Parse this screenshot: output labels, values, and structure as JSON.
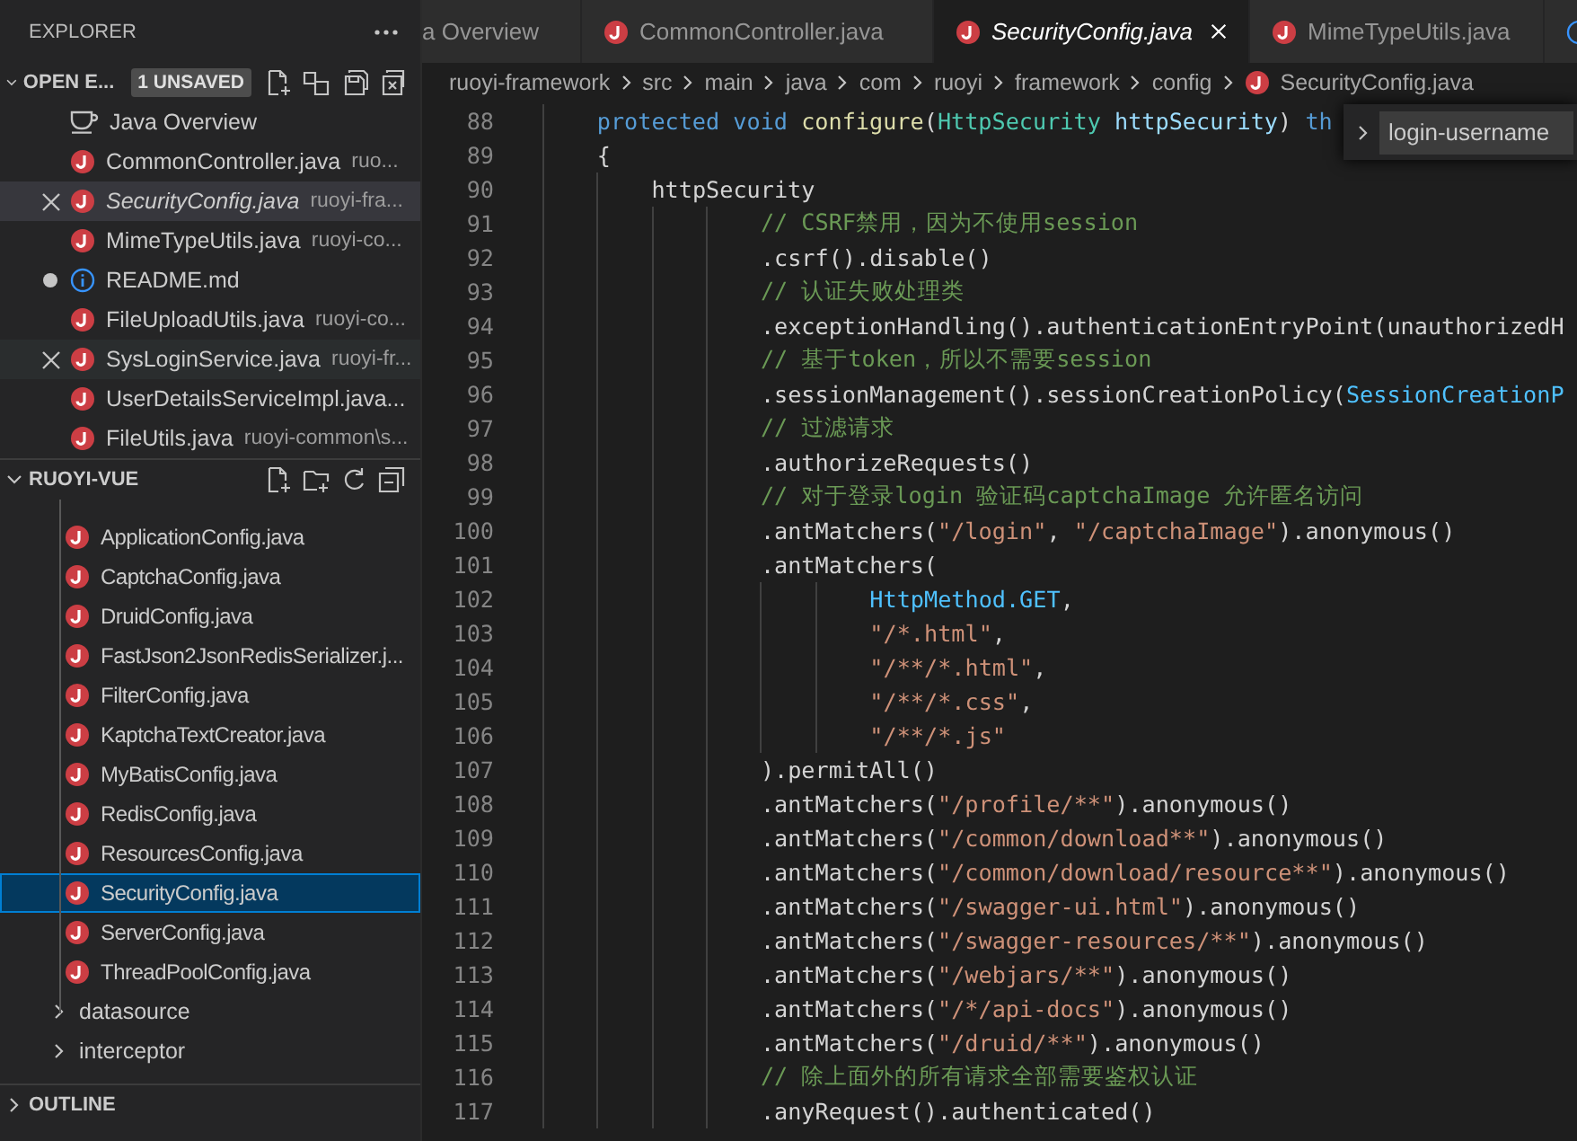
{
  "sidebar": {
    "title": "EXPLORER",
    "open_editors": {
      "title": "OPEN E...",
      "badge": "1 UNSAVED",
      "items": [
        {
          "kind": "overview",
          "name": "Java Overview",
          "selected": false,
          "hovered": false,
          "dirty": false,
          "preview": false
        },
        {
          "kind": "java",
          "name": "CommonController.java",
          "description": "ruo...",
          "selected": false,
          "hovered": false,
          "dirty": false,
          "preview": false
        },
        {
          "kind": "java",
          "name": "SecurityConfig.java",
          "description": "ruoyi-fra...",
          "selected": true,
          "hovered": false,
          "dirty": false,
          "preview": true
        },
        {
          "kind": "java",
          "name": "MimeTypeUtils.java",
          "description": "ruoyi-co...",
          "selected": false,
          "hovered": false,
          "dirty": false,
          "preview": false
        },
        {
          "kind": "info",
          "name": "README.md",
          "selected": false,
          "hovered": false,
          "dirty": true,
          "preview": false
        },
        {
          "kind": "java",
          "name": "FileUploadUtils.java",
          "description": "ruoyi-co...",
          "selected": false,
          "hovered": false,
          "dirty": false,
          "preview": false
        },
        {
          "kind": "java",
          "name": "SysLoginService.java",
          "description": "ruoyi-fr...",
          "selected": false,
          "hovered": true,
          "dirty": false,
          "preview": false
        },
        {
          "kind": "java",
          "name": "UserDetailsServiceImpl.java...",
          "selected": false,
          "hovered": false,
          "dirty": false,
          "preview": false
        },
        {
          "kind": "java",
          "name": "FileUtils.java",
          "description": "ruoyi-common\\s...",
          "selected": false,
          "hovered": false,
          "dirty": false,
          "preview": false
        }
      ]
    },
    "project": {
      "title": "RUOYI-VUE",
      "config_files": [
        {
          "name": "ApplicationConfig.java",
          "selected": false
        },
        {
          "name": "CaptchaConfig.java",
          "selected": false
        },
        {
          "name": "DruidConfig.java",
          "selected": false
        },
        {
          "name": "FastJson2JsonRedisSerializer.j...",
          "selected": false
        },
        {
          "name": "FilterConfig.java",
          "selected": false
        },
        {
          "name": "KaptchaTextCreator.java",
          "selected": false
        },
        {
          "name": "MyBatisConfig.java",
          "selected": false
        },
        {
          "name": "RedisConfig.java",
          "selected": false
        },
        {
          "name": "ResourcesConfig.java",
          "selected": false
        },
        {
          "name": "SecurityConfig.java",
          "selected": true
        },
        {
          "name": "ServerConfig.java",
          "selected": false
        },
        {
          "name": "ThreadPoolConfig.java",
          "selected": false
        }
      ],
      "folders": [
        {
          "name": "datasource",
          "expanded": false
        },
        {
          "name": "interceptor",
          "expanded": false
        }
      ]
    },
    "outline": {
      "title": "OUTLINE",
      "expanded": false
    }
  },
  "tabs": [
    {
      "kind": "none",
      "label": "a Overview",
      "selected": false,
      "preview": false
    },
    {
      "kind": "java",
      "label": "CommonController.java",
      "selected": false,
      "preview": false
    },
    {
      "kind": "java",
      "label": "SecurityConfig.java",
      "selected": true,
      "preview": true
    },
    {
      "kind": "java",
      "label": "MimeTypeUtils.java",
      "selected": false,
      "preview": false
    },
    {
      "kind": "info",
      "selected": false
    }
  ],
  "breadcrumbs": [
    {
      "label": "ruoyi-framework"
    },
    {
      "label": "src"
    },
    {
      "label": "main"
    },
    {
      "label": "java"
    },
    {
      "label": "com"
    },
    {
      "label": "ruoyi"
    },
    {
      "label": "framework"
    },
    {
      "label": "config"
    },
    {
      "label": "SecurityConfig.java",
      "kind": "java"
    }
  ],
  "find_widget": {
    "expanded": false,
    "value": "login-username"
  },
  "editor": {
    "lines": [
      {
        "number": "88",
        "tokens": [
          {
            "kind": "keyword",
            "text": "    protected void "
          },
          {
            "kind": "function",
            "text": "configure"
          },
          {
            "kind": "plain",
            "text": "("
          },
          {
            "kind": "type",
            "text": "HttpSecurity "
          },
          {
            "kind": "variable",
            "text": "httpSecurity"
          },
          {
            "kind": "plain",
            "text": ") "
          },
          {
            "kind": "keyword",
            "text": "th"
          }
        ]
      },
      {
        "number": "89",
        "tokens": [
          {
            "kind": "plain",
            "text": "    {"
          }
        ]
      },
      {
        "number": "90",
        "tokens": [
          {
            "kind": "plain",
            "text": "        httpSecurity"
          }
        ]
      },
      {
        "number": "91",
        "tokens": [
          {
            "kind": "comment",
            "text": "                // CSRF禁用，因为不使用session"
          }
        ]
      },
      {
        "number": "92",
        "tokens": [
          {
            "kind": "plain",
            "text": "                .csrf().disable()"
          }
        ]
      },
      {
        "number": "93",
        "tokens": [
          {
            "kind": "comment",
            "text": "                // 认证失败处理类"
          }
        ]
      },
      {
        "number": "94",
        "tokens": [
          {
            "kind": "plain",
            "text": "                .exceptionHandling().authenticationEntryPoint(unauthorizedH"
          }
        ]
      },
      {
        "number": "95",
        "tokens": [
          {
            "kind": "comment",
            "text": "                // 基于token，所以不需要session"
          }
        ]
      },
      {
        "number": "96",
        "tokens": [
          {
            "kind": "plain",
            "text": "                .sessionManagement().sessionCreationPolicy("
          },
          {
            "kind": "constant",
            "text": "SessionCreationP"
          }
        ]
      },
      {
        "number": "97",
        "tokens": [
          {
            "kind": "comment",
            "text": "                // 过滤请求"
          }
        ]
      },
      {
        "number": "98",
        "tokens": [
          {
            "kind": "plain",
            "text": "                .authorizeRequests()"
          }
        ]
      },
      {
        "number": "99",
        "tokens": [
          {
            "kind": "comment",
            "text": "                // 对于登录login 验证码captchaImage 允许匿名访问"
          }
        ]
      },
      {
        "number": "100",
        "tokens": [
          {
            "kind": "plain",
            "text": "                .antMatchers("
          },
          {
            "kind": "string",
            "text": "\"/login\""
          },
          {
            "kind": "plain",
            "text": ", "
          },
          {
            "kind": "string",
            "text": "\"/captchaImage\""
          },
          {
            "kind": "plain",
            "text": ").anonymous()"
          }
        ]
      },
      {
        "number": "101",
        "tokens": [
          {
            "kind": "plain",
            "text": "                .antMatchers("
          }
        ]
      },
      {
        "number": "102",
        "tokens": [
          {
            "kind": "constant",
            "text": "                        HttpMethod.GET"
          },
          {
            "kind": "plain",
            "text": ","
          }
        ]
      },
      {
        "number": "103",
        "tokens": [
          {
            "kind": "string",
            "text": "                        \"/*.html\""
          },
          {
            "kind": "plain",
            "text": ","
          }
        ]
      },
      {
        "number": "104",
        "tokens": [
          {
            "kind": "string",
            "text": "                        \"/**/*.html\""
          },
          {
            "kind": "plain",
            "text": ","
          }
        ]
      },
      {
        "number": "105",
        "tokens": [
          {
            "kind": "string",
            "text": "                        \"/**/*.css\""
          },
          {
            "kind": "plain",
            "text": ","
          }
        ]
      },
      {
        "number": "106",
        "tokens": [
          {
            "kind": "string",
            "text": "                        \"/**/*.js\""
          }
        ]
      },
      {
        "number": "107",
        "tokens": [
          {
            "kind": "plain",
            "text": "                ).permitAll()"
          }
        ]
      },
      {
        "number": "108",
        "tokens": [
          {
            "kind": "plain",
            "text": "                .antMatchers("
          },
          {
            "kind": "string",
            "text": "\"/profile/**\""
          },
          {
            "kind": "plain",
            "text": ").anonymous()"
          }
        ]
      },
      {
        "number": "109",
        "tokens": [
          {
            "kind": "plain",
            "text": "                .antMatchers("
          },
          {
            "kind": "string",
            "text": "\"/common/download**\""
          },
          {
            "kind": "plain",
            "text": ").anonymous()"
          }
        ]
      },
      {
        "number": "110",
        "tokens": [
          {
            "kind": "plain",
            "text": "                .antMatchers("
          },
          {
            "kind": "string",
            "text": "\"/common/download/resource**\""
          },
          {
            "kind": "plain",
            "text": ").anonymous()"
          }
        ]
      },
      {
        "number": "111",
        "tokens": [
          {
            "kind": "plain",
            "text": "                .antMatchers("
          },
          {
            "kind": "string",
            "text": "\"/swagger-ui.html\""
          },
          {
            "kind": "plain",
            "text": ").anonymous()"
          }
        ]
      },
      {
        "number": "112",
        "tokens": [
          {
            "kind": "plain",
            "text": "                .antMatchers("
          },
          {
            "kind": "string",
            "text": "\"/swagger-resources/**\""
          },
          {
            "kind": "plain",
            "text": ").anonymous()"
          }
        ]
      },
      {
        "number": "113",
        "tokens": [
          {
            "kind": "plain",
            "text": "                .antMatchers("
          },
          {
            "kind": "string",
            "text": "\"/webjars/**\""
          },
          {
            "kind": "plain",
            "text": ").anonymous()"
          }
        ]
      },
      {
        "number": "114",
        "tokens": [
          {
            "kind": "plain",
            "text": "                .antMatchers("
          },
          {
            "kind": "string",
            "text": "\"/*/api-docs\""
          },
          {
            "kind": "plain",
            "text": ").anonymous()"
          }
        ]
      },
      {
        "number": "115",
        "tokens": [
          {
            "kind": "plain",
            "text": "                .antMatchers("
          },
          {
            "kind": "string",
            "text": "\"/druid/**\""
          },
          {
            "kind": "plain",
            "text": ").anonymous()"
          }
        ]
      },
      {
        "number": "116",
        "tokens": [
          {
            "kind": "comment",
            "text": "                // 除上面外的所有请求全部需要鉴权认证"
          }
        ]
      },
      {
        "number": "117",
        "tokens": [
          {
            "kind": "plain",
            "text": "                .anyRequest().authenticated()"
          }
        ]
      }
    ]
  }
}
